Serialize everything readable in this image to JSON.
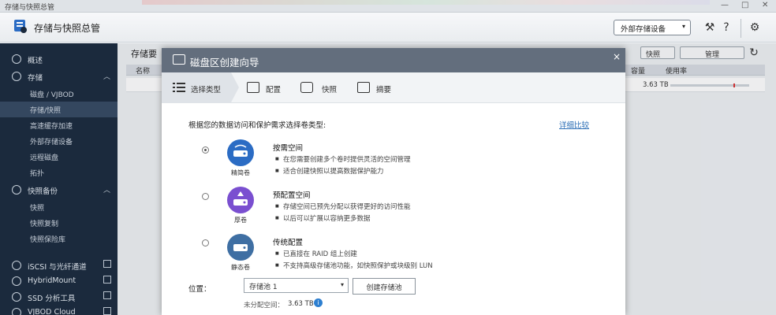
{
  "window": {
    "title": "存储与快照总管",
    "controls": [
      "—",
      "□",
      "✕"
    ]
  },
  "header": {
    "app_title": "存储与快照总管",
    "external_device_btn": "外部存储设备",
    "icons": [
      "search-tools-icon",
      "help-icon",
      "settings-icon"
    ]
  },
  "sidebar": {
    "items": [
      {
        "label": "概述",
        "icon": "dashboard-icon"
      },
      {
        "label": "存储",
        "icon": "storage-icon"
      },
      {
        "label": "磁盘 / VJBOD"
      },
      {
        "label": "存储/快照"
      },
      {
        "label": "高速缓存加速"
      },
      {
        "label": "外部存储设备"
      },
      {
        "label": "远程磁盘"
      },
      {
        "label": "拓扑"
      },
      {
        "label": "快照备份",
        "icon": "snapshot-icon"
      },
      {
        "label": "快照"
      },
      {
        "label": "快照复制"
      },
      {
        "label": "快照保险库"
      },
      {
        "label": "iSCSI 与光纤通道",
        "icon": "iscsi-icon"
      },
      {
        "label": "HybridMount",
        "icon": "hybridmount-icon"
      },
      {
        "label": "SSD 分析工具",
        "icon": "ssd-icon"
      },
      {
        "label": "VJBOD Cloud",
        "icon": "cloud-icon"
      }
    ]
  },
  "background": {
    "section_title": "存储要",
    "table_header_left": "名称",
    "col_capacity": "容量",
    "col_usage": "使用率",
    "row_capacity": "3.63 TB",
    "btn_snapshot": "快照",
    "btn_manage": "管理"
  },
  "modal": {
    "title": "磁盘区创建向导",
    "close": "×",
    "steps": [
      {
        "label": "选择类型",
        "icon": "list-icon"
      },
      {
        "label": "配置",
        "icon": "config-icon"
      },
      {
        "label": "快照",
        "icon": "camera-icon"
      },
      {
        "label": "摘要",
        "icon": "summary-icon"
      }
    ],
    "intro": "根据您的数据访问和保护需求选择卷类型:",
    "compare_link": "详细比较",
    "options": [
      {
        "caption": "精简卷",
        "title": "按需空间",
        "bullets": [
          "在您需要创建多个卷时提供灵活的空间管理",
          "适合创建快照以提高数据保护能力"
        ],
        "color": "#2b6cc4",
        "selected": true
      },
      {
        "caption": "厚卷",
        "title": "预配置空间",
        "bullets": [
          "存储空间已预先分配以获得更好的访问性能",
          "以后可以扩展以容纳更多数据"
        ],
        "color": "#7a4fd0",
        "selected": false
      },
      {
        "caption": "静态卷",
        "title": "传统配置",
        "bullets": [
          "已直接在 RAID 组上创建",
          "不支持高级存储池功能，如快照保护或块级别 LUN"
        ],
        "color": "#3f6fa3",
        "selected": false
      }
    ],
    "location_label": "位置：",
    "pool_value": "存储池 1",
    "create_pool_btn": "创建存储池",
    "free_label": "未分配空间：",
    "free_value": "3.63 TB",
    "info": "i"
  }
}
